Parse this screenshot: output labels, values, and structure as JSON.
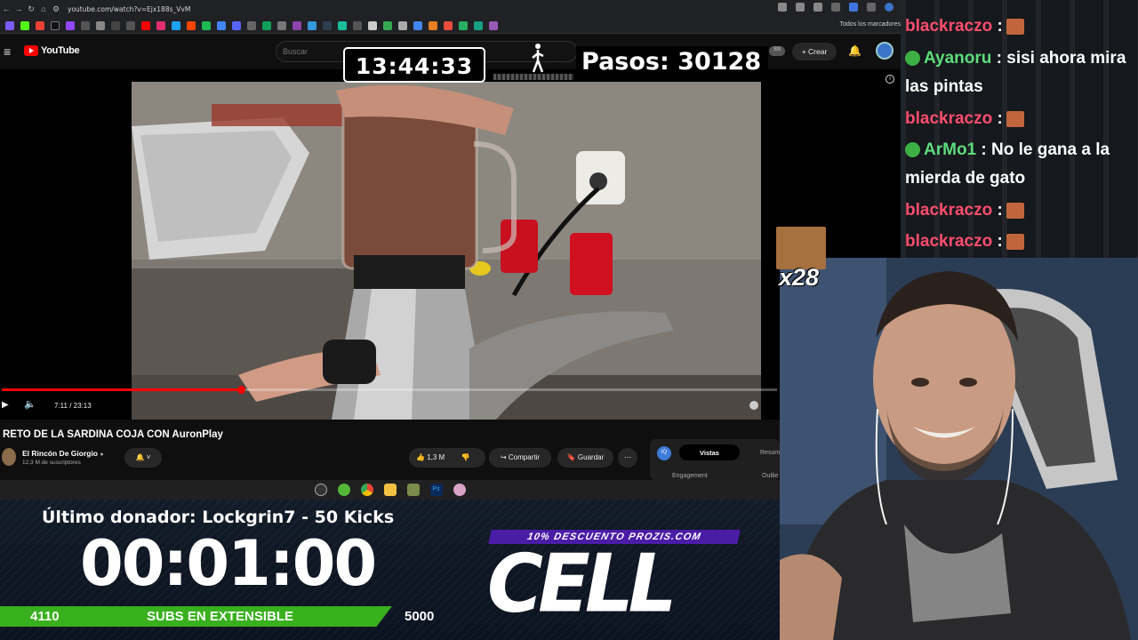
{
  "browser": {
    "url": "youtube.com/watch?v=Ejx188s_VvM",
    "all_bookmarks": "Todos los marcadores"
  },
  "youtube": {
    "logo": "YouTube",
    "search_placeholder": "Buscar",
    "create_label": "Crear",
    "badge": "SS"
  },
  "overlay": {
    "clock": "13:44:33",
    "steps": "Pasos: 30128"
  },
  "player": {
    "time": "7:11 / 23:13",
    "progress": 0.309
  },
  "video": {
    "title": "RETO DE LA SARDINA COJA CON AuronPlay",
    "channel": "El Rincón De Giorgio",
    "subscribers": "12,3 M de suscriptores",
    "likes": "1,3 M",
    "share": "Compartir",
    "save": "Guardar"
  },
  "analytics": {
    "tab_views": "Vistas",
    "tab_summary": "Resum",
    "engagement": "Engagement",
    "outlier": "Outlie"
  },
  "stream": {
    "last_donor": "Último donador: Lockgrin7 - 50 Kicks",
    "timer": "00:01:00",
    "subs_current": "4110",
    "subs_label": "SUBS EN EXTENSIBLE",
    "subs_goal": "5000",
    "subs_progress": 0.822,
    "promo": "10% DESCUENTO PROZIS.COM",
    "sponsor": "CELL",
    "emote_count": "x28"
  },
  "chat": {
    "messages": [
      {
        "user": "blackraczo",
        "sep": " :",
        "text": "",
        "color": "#ff4d6d"
      },
      {
        "user": "Ayanoru",
        "sep": " :",
        "text": "sisi ahora mira las pintas",
        "color": "#5ddc7b"
      },
      {
        "user": "blackraczo",
        "sep": " :",
        "text": "",
        "color": "#ff4d6d"
      },
      {
        "user": "ArMo1",
        "sep": " :",
        "text": "No le gana a la mierda de gato",
        "color": "#5ddc7b"
      },
      {
        "user": "blackraczo",
        "sep": " :",
        "text": "",
        "color": "#ff4d6d"
      },
      {
        "user": "blackraczo",
        "sep": " :",
        "text": "",
        "color": "#ff4d6d"
      }
    ]
  }
}
